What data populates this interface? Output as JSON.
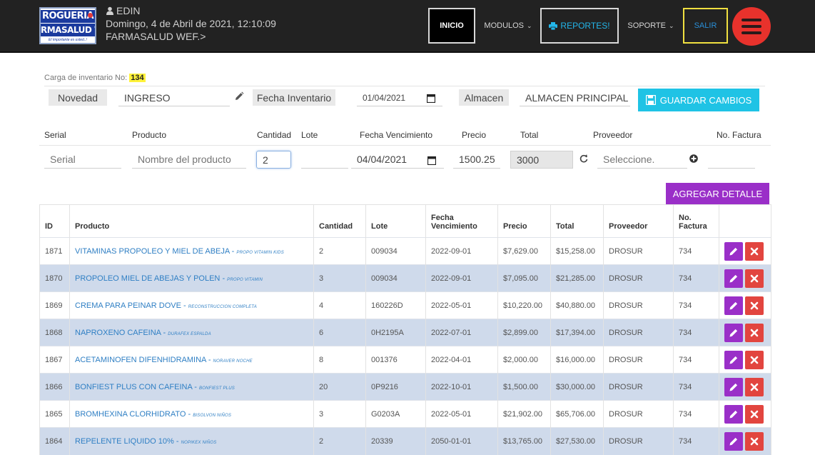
{
  "navbar": {
    "logo": {
      "line1": "ROGUERIA",
      "line2": "RMASALUD W",
      "slogan": "El importante es usted..!"
    },
    "user": {
      "name": "EDIN",
      "datetime": "Domingo, 4 de Abril de 2021, 12:10:09",
      "store": "FARMASALUD WEF.>"
    },
    "menu": {
      "inicio": "INICIO",
      "modulos": "MODULOS",
      "reportes": "REPORTES!",
      "soporte": "SOPORTE",
      "salir": "SALIR"
    }
  },
  "header": {
    "carga_label": "Carga de inventario No:",
    "carga_number": "134",
    "novedad_label": "Novedad",
    "novedad_value": "INGRESO",
    "fecha_label": "Fecha Inventario",
    "fecha_value": "01/04/2021",
    "almacen_label": "Almacen",
    "almacen_value": "ALMACEN PRINCIPAL",
    "guardar_label": "GUARDAR CAMBIOS"
  },
  "detail_form": {
    "labels": {
      "serial": "Serial",
      "producto": "Producto",
      "cantidad": "Cantidad",
      "lote": "Lote",
      "fecha_vencimiento": "Fecha Vencimiento",
      "precio": "Precio",
      "total": "Total",
      "proveedor": "Proveedor",
      "factura": "No. Factura"
    },
    "serial_placeholder": "Serial",
    "producto_placeholder": "Nombre del producto",
    "cantidad_value": "2",
    "lote_value": "",
    "fecha_value": "04/04/2021",
    "precio_value": "1500.25",
    "total_value": "3000",
    "proveedor_placeholder": "Seleccione.",
    "factura_value": "",
    "agregar_label": "AGREGAR DETALLE"
  },
  "table": {
    "headers": {
      "id": "ID",
      "producto": "Producto",
      "cantidad": "Cantidad",
      "lote": "Lote",
      "fecha_line1": "Fecha",
      "fecha_line2": "Vencimiento",
      "precio": "Precio",
      "total": "Total",
      "proveedor": "Proveedor",
      "factura_line1": "No.",
      "factura_line2": "Factura"
    },
    "rows": [
      {
        "id": "1871",
        "producto": "VITAMINAS PROPOLEO Y MIEL DE ABEJA",
        "sub": "PROPO VITAMIN KIDS",
        "cantidad": "2",
        "lote": "009034",
        "fecha": "2022-09-01",
        "precio": "$7,629.00",
        "total": "$15,258.00",
        "proveedor": "DROSUR",
        "factura": "734"
      },
      {
        "id": "1870",
        "producto": "PROPOLEO MIEL DE ABEJAS Y POLEN",
        "sub": "PROPO VITAMIN",
        "cantidad": "3",
        "lote": "009034",
        "fecha": "2022-09-01",
        "precio": "$7,095.00",
        "total": "$21,285.00",
        "proveedor": "DROSUR",
        "factura": "734"
      },
      {
        "id": "1869",
        "producto": "CREMA PARA PEINAR DOVE",
        "sub": "RECONSTRUCCION COMPLETA",
        "cantidad": "4",
        "lote": "160226D",
        "fecha": "2022-05-01",
        "precio": "$10,220.00",
        "total": "$40,880.00",
        "proveedor": "DROSUR",
        "factura": "734"
      },
      {
        "id": "1868",
        "producto": "NAPROXENO CAFEINA",
        "sub": "DURAFEX ESPALDA",
        "cantidad": "6",
        "lote": "0H2195A",
        "fecha": "2022-07-01",
        "precio": "$2,899.00",
        "total": "$17,394.00",
        "proveedor": "DROSUR",
        "factura": "734"
      },
      {
        "id": "1867",
        "producto": "ACETAMINOFEN DIFENHIDRAMINA",
        "sub": "NORAVER NOCHE",
        "cantidad": "8",
        "lote": "001376",
        "fecha": "2022-04-01",
        "precio": "$2,000.00",
        "total": "$16,000.00",
        "proveedor": "DROSUR",
        "factura": "734"
      },
      {
        "id": "1866",
        "producto": "BONFIEST PLUS CON CAFEINA",
        "sub": "BONFIEST PLUS",
        "cantidad": "20",
        "lote": "0P9216",
        "fecha": "2022-10-01",
        "precio": "$1,500.00",
        "total": "$30,000.00",
        "proveedor": "DROSUR",
        "factura": "734"
      },
      {
        "id": "1865",
        "producto": "BROMHEXINA CLORHIDRATO",
        "sub": "BISOLVON NIÑOS",
        "cantidad": "3",
        "lote": "G0203A",
        "fecha": "2022-05-01",
        "precio": "$21,902.00",
        "total": "$65,706.00",
        "proveedor": "DROSUR",
        "factura": "734"
      },
      {
        "id": "1864",
        "producto": "REPELENTE LIQUIDO 10%",
        "sub": "NOPIKEX NIÑOS",
        "cantidad": "2",
        "lote": "20339",
        "fecha": "2050-01-01",
        "precio": "$13,765.00",
        "total": "$27,530.00",
        "proveedor": "DROSUR",
        "factura": "734"
      }
    ]
  },
  "colors": {
    "navbar_bg": "#222222",
    "accent_cyan": "#1fc3e5",
    "accent_purple": "#9a2fc8",
    "delete_red": "#e2453f",
    "row_stripe": "#cfdaeb",
    "link_blue": "#2f7fc4"
  },
  "icons": [
    "user-icon",
    "caret-down-icon",
    "print-icon",
    "hamburger-menu-icon",
    "pencil-icon",
    "calendar-icon",
    "save-icon",
    "refresh-icon",
    "plus-circle-icon",
    "edit-icon",
    "delete-icon"
  ]
}
